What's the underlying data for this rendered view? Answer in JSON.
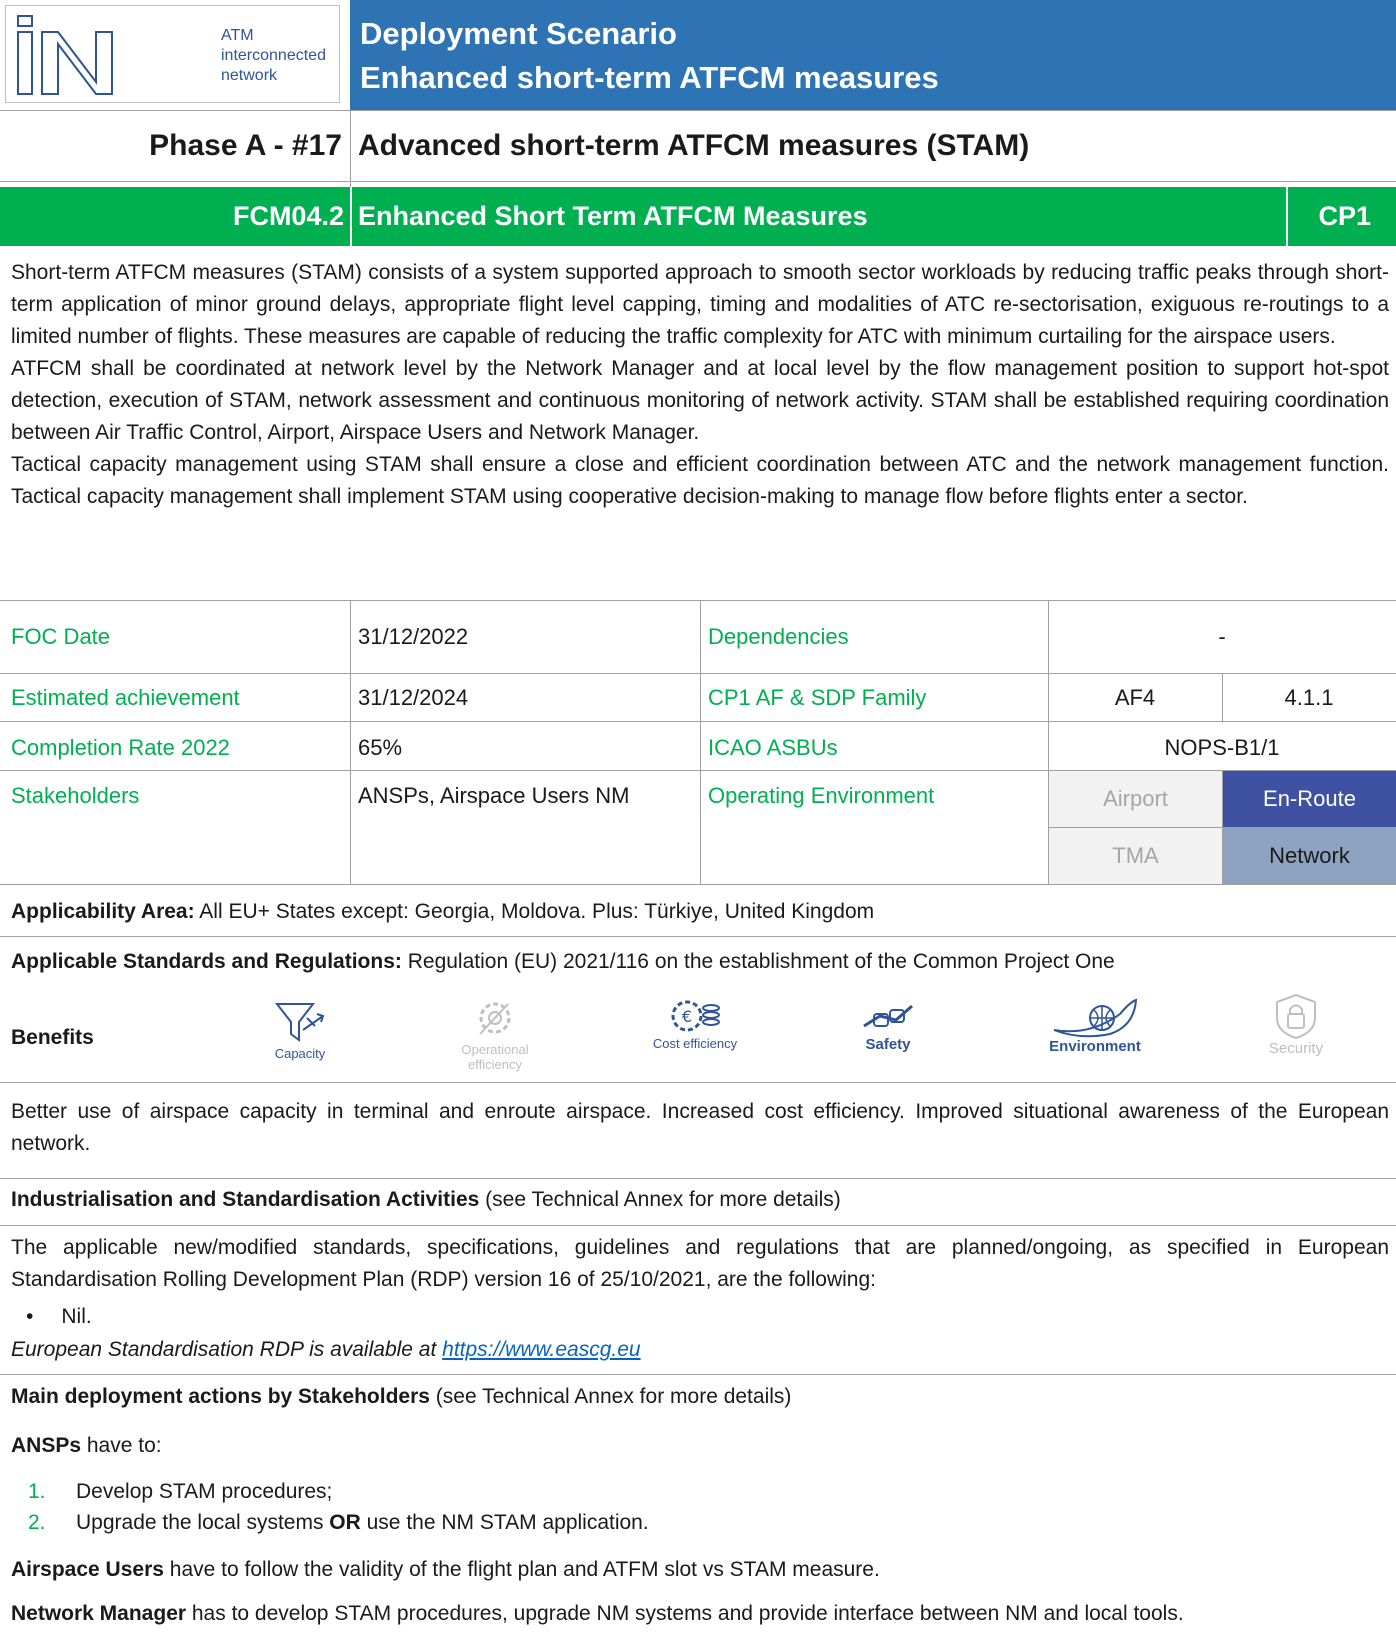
{
  "header": {
    "logo_text_lines": [
      "ATM",
      "interconnected",
      "network"
    ],
    "title_line1": "Deployment Scenario",
    "title_line2": "Enhanced short-term ATFCM measures"
  },
  "phase": {
    "label": "Phase A - #17",
    "title": "Advanced short-term ATFCM measures (STAM)"
  },
  "objective": {
    "code": "FCM04.2",
    "name": "Enhanced Short Term ATFCM Measures",
    "project": "CP1"
  },
  "description": [
    "Short-term ATFCM measures (STAM) consists of a system supported approach to smooth sector workloads by reducing traffic peaks through short-term application of minor ground delays, appropriate flight level capping, timing and modalities of ATC re-sectorisation, exiguous re-routings to a limited number of flights. These measures are capable of reducing the traffic complexity for ATC with minimum curtailing for the airspace users.",
    "ATFCM shall be coordinated at network level by the Network Manager and at local level by the flow management position to support hot-spot detection, execution of STAM, network assessment and continuous monitoring of network activity. STAM shall be established requiring coordination between Air Traffic Control, Airport, Airspace Users and Network Manager.",
    "Tactical capacity management using STAM shall ensure a close and efficient coordination between ATC and the network management function. Tactical capacity management shall implement STAM using cooperative decision-making to manage flow before flights enter a sector."
  ],
  "table": {
    "foc_label": "FOC Date",
    "foc_value": "31/12/2022",
    "dependencies_label": "Dependencies",
    "dependencies_value": "-",
    "estimated_label": "Estimated achievement",
    "estimated_value": "31/12/2024",
    "af_label": "CP1 AF & SDP Family",
    "af_value": "AF4",
    "sdp_value": "4.1.1",
    "completion_label": "Completion Rate 2022",
    "completion_value": "65%",
    "icao_label": "ICAO ASBUs",
    "icao_value": "NOPS-B1/1",
    "stakeholders_label": "Stakeholders",
    "stakeholders_value": "ANSPs, Airspace Users NM",
    "environment_label": "Operating Environment",
    "env_airport": "Airport",
    "env_enroute": "En-Route",
    "env_tma": "TMA",
    "env_network": "Network"
  },
  "applicability": {
    "label": "Applicability Area:",
    "text": " All EU+ States except: Georgia, Moldova. Plus: Türkiye, United Kingdom"
  },
  "standards": {
    "label": "Applicable Standards and Regulations:",
    "text": " Regulation (EU) 2021/116 on the establishment of the Common Project One"
  },
  "benefits": {
    "label": "Benefits",
    "items": [
      {
        "name": "Capacity",
        "icon": "capacity-icon",
        "active": true
      },
      {
        "name": "Operational efficiency",
        "icon": "operational-efficiency-icon",
        "active": false
      },
      {
        "name": "Cost efficiency",
        "icon": "cost-efficiency-icon",
        "active": true
      },
      {
        "name": "Safety",
        "icon": "safety-icon",
        "active": true
      },
      {
        "name": "Environment",
        "icon": "environment-icon",
        "active": true
      },
      {
        "name": "Security",
        "icon": "security-icon",
        "active": false
      }
    ],
    "summary": "Better use of airspace capacity in terminal and enroute airspace. Increased cost efficiency. Improved situational awareness of the European network."
  },
  "industrialisation": {
    "label": "Industrialisation and Standardisation Activities",
    "suffix": " (see Technical Annex for more details)",
    "text": "The applicable new/modified standards, specifications, guidelines and regulations that are planned/ongoing, as specified in European Standardisation Rolling Development Plan (RDP) version 16 of 25/10/2021, are the following:",
    "bullet": "Nil.",
    "rdp_prefix": "European Standardisation RDP is available at ",
    "rdp_link": "https://www.eascg.eu"
  },
  "actions": {
    "label": "Main deployment actions by Stakeholders",
    "suffix": " (see Technical Annex for more details)",
    "ansps_label": "ANSPs",
    "ansps_suffix": " have to:",
    "ansps_items": [
      {
        "num": "1.",
        "text_before": "Develop STAM procedures;",
        "bold": "",
        "text_after": ""
      },
      {
        "num": "2.",
        "text_before": "Upgrade the local systems ",
        "bold": "OR",
        "text_after": " use the NM STAM application."
      }
    ],
    "au_label": "Airspace Users",
    "au_text": " have to follow the validity of the flight plan and ATFM slot vs STAM measure.",
    "nm_label": "Network Manager",
    "nm_text": " has to develop STAM procedures, upgrade NM systems and provide interface between NM and local tools."
  }
}
